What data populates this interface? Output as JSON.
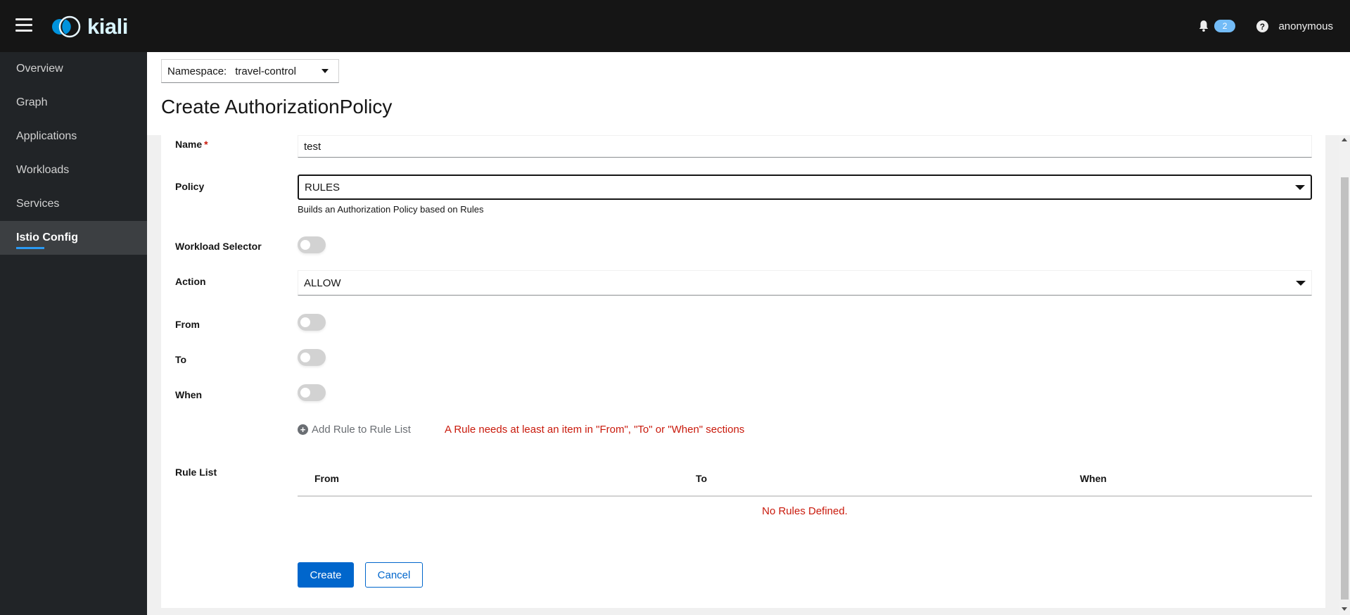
{
  "header": {
    "brand": "kiali",
    "notifications_count": "2",
    "user": "anonymous"
  },
  "sidebar": {
    "items": [
      {
        "label": "Overview",
        "active": false
      },
      {
        "label": "Graph",
        "active": false
      },
      {
        "label": "Applications",
        "active": false
      },
      {
        "label": "Workloads",
        "active": false
      },
      {
        "label": "Services",
        "active": false
      },
      {
        "label": "Istio Config",
        "active": true
      }
    ]
  },
  "namespace": {
    "label": "Namespace:",
    "value": "travel-control"
  },
  "page": {
    "title": "Create AuthorizationPolicy"
  },
  "form": {
    "name": {
      "label": "Name",
      "required_mark": "*",
      "value": "test"
    },
    "policy": {
      "label": "Policy",
      "value": "RULES",
      "helper": "Builds an Authorization Policy based on Rules"
    },
    "workload_selector": {
      "label": "Workload Selector",
      "enabled": false
    },
    "action": {
      "label": "Action",
      "value": "ALLOW"
    },
    "from": {
      "label": "From",
      "enabled": false
    },
    "to": {
      "label": "To",
      "enabled": false
    },
    "when": {
      "label": "When",
      "enabled": false
    },
    "add_rule": {
      "label": "Add Rule to Rule List",
      "error": "A Rule needs at least an item in \"From\", \"To\" or \"When\" sections"
    },
    "rule_list": {
      "label": "Rule List",
      "columns": [
        "From",
        "To",
        "When"
      ],
      "empty_message": "No Rules Defined."
    },
    "buttons": {
      "create": "Create",
      "cancel": "Cancel"
    }
  }
}
